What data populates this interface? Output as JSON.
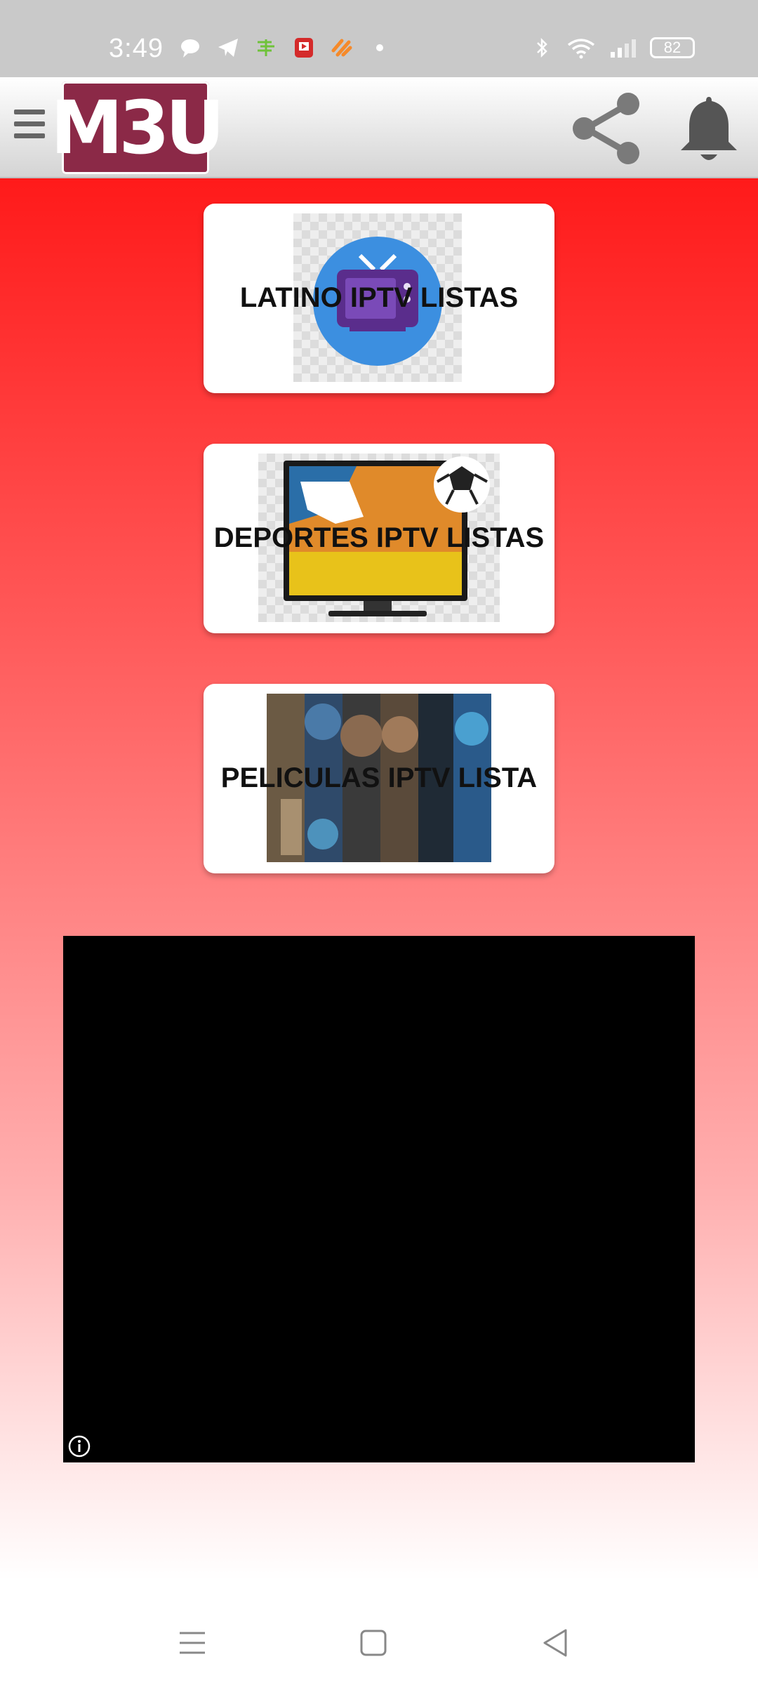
{
  "status_bar": {
    "time": "3:49",
    "left_icons": [
      "chat-bubble-icon",
      "telegram-icon",
      "money-app-icon",
      "video-app-icon",
      "stripe-app-icon",
      "dot-icon"
    ],
    "right_icons": [
      "bluetooth-icon",
      "wifi-icon",
      "signal-icon"
    ],
    "battery": "82"
  },
  "app_bar": {
    "logo_text": "M3U",
    "menu_icon": "hamburger-menu-icon",
    "share_icon": "share-icon",
    "bell_icon": "bell-icon",
    "logo_color": "#8b2947"
  },
  "cards": [
    {
      "label": "LATINO IPTV LISTAS",
      "image": "tv-icon-image"
    },
    {
      "label": "DEPORTES IPTV LISTAS",
      "image": "soccer-tv-image"
    },
    {
      "label": "PELICULAS IPTV LISTA",
      "image": "movie-posters-image"
    }
  ],
  "ad": {
    "info_icon": "info-icon"
  },
  "nav_bar": {
    "icons": [
      "recent-apps-icon",
      "home-icon",
      "back-icon"
    ]
  },
  "colors": {
    "background_top": "#ff1a1a",
    "background_bottom": "#ffffff"
  }
}
